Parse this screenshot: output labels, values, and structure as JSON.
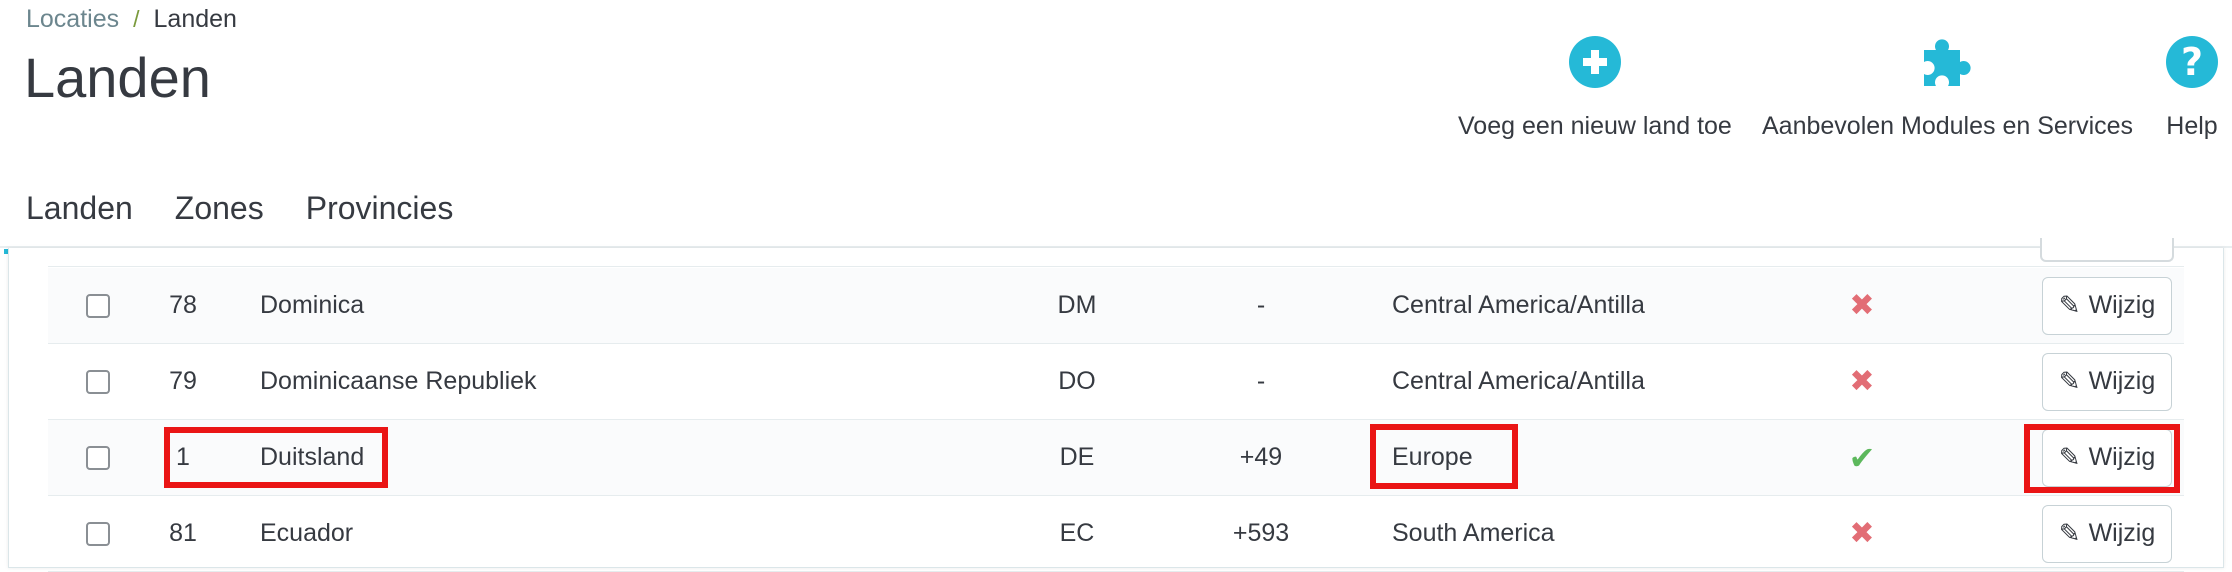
{
  "breadcrumb": {
    "parent": "Locaties",
    "separator": "/",
    "current": "Landen"
  },
  "page_title": "Landen",
  "toolbar": {
    "add_label": "Voeg een nieuw land toe",
    "modules_label": "Aanbevolen Modules en Services",
    "help_label": "Help"
  },
  "tabs": [
    {
      "label": "Landen",
      "active": true
    },
    {
      "label": "Zones",
      "active": false
    },
    {
      "label": "Provincies",
      "active": false
    }
  ],
  "rows": [
    {
      "id": "78",
      "name": "Dominica",
      "iso": "DM",
      "prefix": "-",
      "zone": "Central America/Antilla",
      "enabled": false
    },
    {
      "id": "79",
      "name": "Dominicaanse Republiek",
      "iso": "DO",
      "prefix": "-",
      "zone": "Central America/Antilla",
      "enabled": false
    },
    {
      "id": "1",
      "name": "Duitsland",
      "iso": "DE",
      "prefix": "+49",
      "zone": "Europe",
      "enabled": true
    },
    {
      "id": "81",
      "name": "Ecuador",
      "iso": "EC",
      "prefix": "+593",
      "zone": "South America",
      "enabled": false
    }
  ],
  "edit_label": "Wijzig",
  "colors": {
    "accent": "#25b9d7",
    "highlight": "#ea1515",
    "status_off": "#e26d75",
    "status_on": "#5cb85c"
  },
  "icons": {
    "add": "plus-circle-icon",
    "modules": "puzzle-icon",
    "help": "question-circle-icon",
    "edit": "pencil-icon"
  }
}
